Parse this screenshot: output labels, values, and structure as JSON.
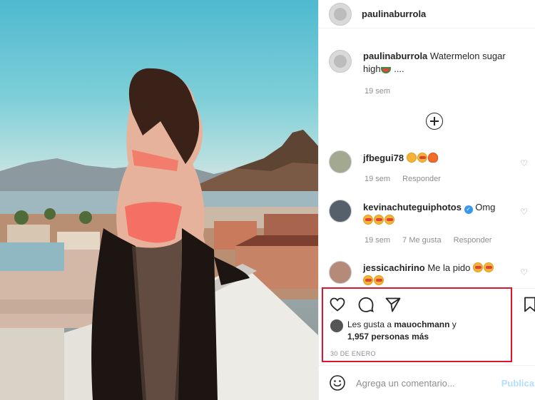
{
  "post": {
    "username": "paulinaburrola"
  },
  "caption": {
    "username": "paulinaburrola",
    "text": "Watermelon sugar",
    "text_line2": "high",
    "suffix": "....",
    "time": "19 sem"
  },
  "comments": [
    {
      "username": "jfbegui78",
      "text": "",
      "time": "19 sem",
      "likes": "",
      "reply": "Responder"
    },
    {
      "username": "kevinachuteguiphotos",
      "text": "Omg",
      "time": "19 sem",
      "likes": "7 Me gusta",
      "reply": "Responder"
    },
    {
      "username": "jessicachirino",
      "text": "Me la pido",
      "time": "",
      "likes": "",
      "reply": ""
    }
  ],
  "likes": {
    "prefix": "Les gusta a",
    "user": "mauochmann",
    "suffix_a": "y",
    "count": "1,957",
    "suffix_b": "personas más"
  },
  "date": "30 DE ENERO",
  "composer": {
    "placeholder": "Agrega un comentario...",
    "publish": "Publica"
  },
  "colors": {
    "highlight_box": "#e0142b",
    "verified": "#3897f0",
    "publish_disabled": "#b2dffc"
  },
  "icons": [
    "heart-icon",
    "comment-icon",
    "share-icon",
    "bookmark-icon",
    "add-comment-icon",
    "emoji-icon",
    "verified-icon",
    "like-comment-icon"
  ]
}
